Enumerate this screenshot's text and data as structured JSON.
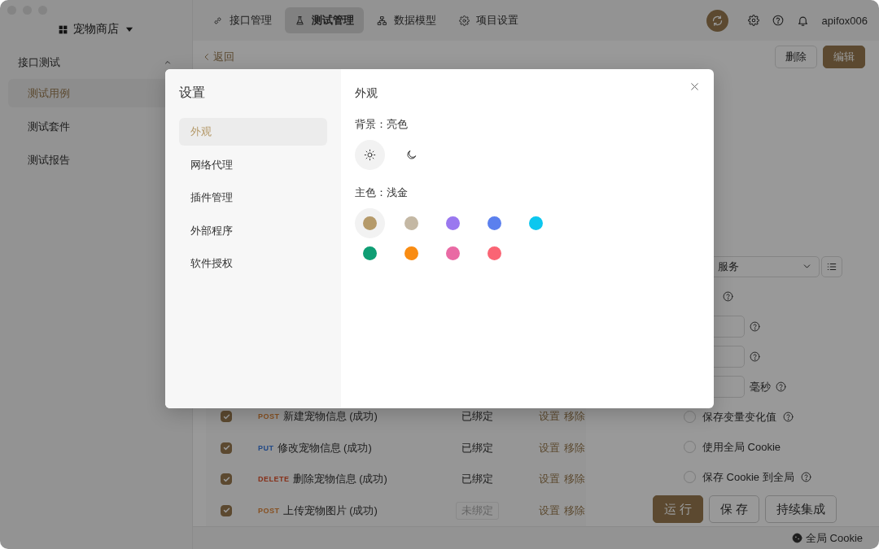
{
  "sidebar": {
    "project": "宠物商店",
    "section": {
      "label": "接口测试",
      "expanded": true
    },
    "items": [
      {
        "label": "测试用例",
        "selected": true
      },
      {
        "label": "测试套件",
        "selected": false
      },
      {
        "label": "测试报告",
        "selected": false
      }
    ]
  },
  "topbar": {
    "tabs": [
      {
        "label": "接口管理",
        "selected": false
      },
      {
        "label": "测试管理",
        "selected": true
      },
      {
        "label": "数据模型",
        "selected": false
      },
      {
        "label": "项目设置",
        "selected": false
      }
    ],
    "user": "apifox006"
  },
  "header": {
    "back": "返回",
    "buttons": [
      "删除",
      "编辑"
    ]
  },
  "table": {
    "rows": [
      {
        "checked": true,
        "method": "POST",
        "kind": "create",
        "name": "新建宠物信息 (成功)",
        "binding": "已绑定",
        "bound": true,
        "actions": [
          "设置",
          "移除"
        ]
      },
      {
        "checked": true,
        "method": "PUT",
        "kind": "update",
        "name": "修改宠物信息 (成功)",
        "binding": "已绑定",
        "bound": true,
        "actions": [
          "设置",
          "移除"
        ]
      },
      {
        "checked": true,
        "method": "DELETE",
        "kind": "remove",
        "name": "删除宠物信息 (成功)",
        "binding": "已绑定",
        "bound": true,
        "actions": [
          "设置",
          "移除"
        ]
      },
      {
        "checked": true,
        "method": "POST",
        "kind": "create",
        "name": "上传宠物图片 (成功)",
        "binding": "未绑定",
        "bound": false,
        "actions": [
          "设置",
          "移除"
        ]
      }
    ]
  },
  "run_panel": {
    "environment": "服务",
    "timeout_field": {
      "unit": "毫秒"
    },
    "options": [
      {
        "label": "保存变量变化值",
        "checked": false,
        "help": true
      },
      {
        "label": "使用全局 Cookie",
        "checked": false,
        "help": false
      },
      {
        "label": "保存 Cookie 到全局",
        "checked": false,
        "help": true
      }
    ],
    "buttons": [
      {
        "label": "运 行",
        "primary": true
      },
      {
        "label": "保 存",
        "primary": false
      },
      {
        "label": "持续集成",
        "primary": false
      }
    ]
  },
  "status_bar": {
    "cookie": "全局 Cookie"
  },
  "settings_modal": {
    "title": "设置",
    "nav": [
      {
        "label": "外观",
        "selected": true
      },
      {
        "label": "网络代理",
        "selected": false
      },
      {
        "label": "插件管理",
        "selected": false
      },
      {
        "label": "外部程序",
        "selected": false
      },
      {
        "label": "软件授权",
        "selected": false
      }
    ],
    "pane_title": "外观",
    "background_label": "背景：亮色",
    "themes": [
      {
        "kind": "light",
        "selected": true
      },
      {
        "kind": "dark",
        "selected": false
      }
    ],
    "color_label": "主色：浅金",
    "colors": [
      {
        "color": "#b59a6a",
        "selected": true
      },
      {
        "color": "#c4b8a4",
        "selected": false
      },
      {
        "color": "#9a78ef",
        "selected": false
      },
      {
        "color": "#5b80ee",
        "selected": false
      },
      {
        "color": "#0cc7ef",
        "selected": false
      },
      {
        "color": "#0f9e74",
        "selected": false
      },
      {
        "color": "#f98c12",
        "selected": false
      },
      {
        "color": "#e96aa4",
        "selected": false
      },
      {
        "color": "#fa6474",
        "selected": false
      }
    ]
  }
}
